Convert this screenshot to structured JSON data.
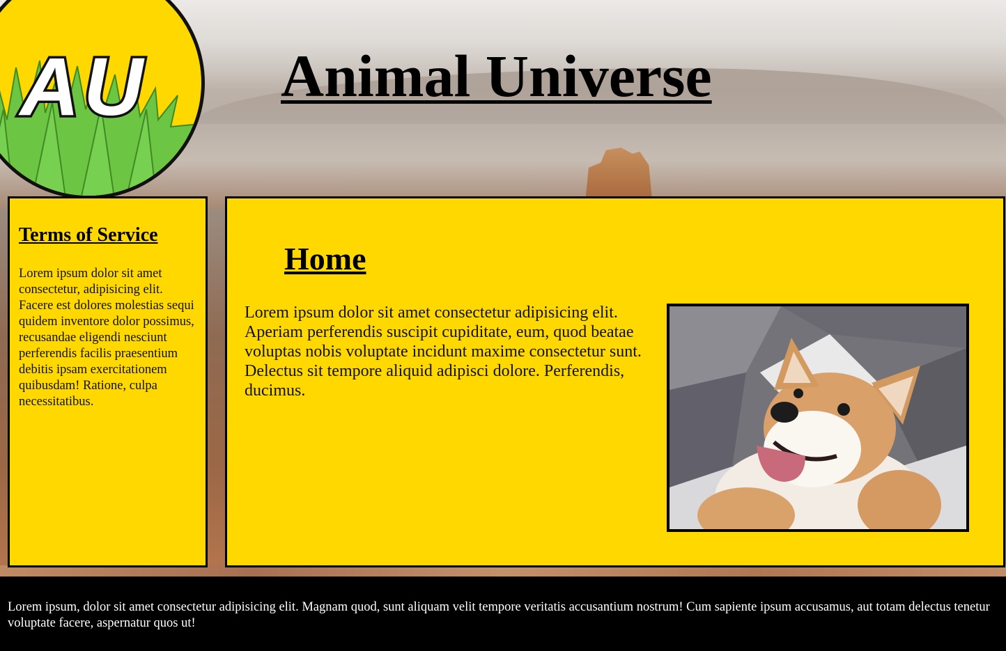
{
  "logo": {
    "text": "AU",
    "icon": "animal-universe-logo-icon",
    "color": "#ffd800"
  },
  "header": {
    "title": "Animal Universe"
  },
  "sidebar": {
    "heading": "Terms of Service",
    "text": "Lorem ipsum dolor sit amet consectetur, adipisicing elit. Facere est dolores molestias sequi quidem inventore dolor possimus, recusandae eligendi nesciunt perferendis facilis praesentium debitis ipsam exercitationem quibusdam! Ratione, culpa necessitatibus."
  },
  "main": {
    "heading": "Home",
    "text": "Lorem ipsum dolor sit amet consectetur adipisicing elit. Aperiam perferendis suscipit cupiditate, eum, quod beatae voluptas nobis voluptate incidunt maxime consectetur sunt. Delectus sit tempore aliquid adipisci dolore. Perferendis, ducimus.",
    "image": "corgi-dog-photo"
  },
  "footer": {
    "text": "Lorem ipsum, dolor sit amet consectetur adipisicing elit. Magnam quod, sunt aliquam velit tempore veritatis accusantium nostrum! Cum sapiente ipsum accusamus, aut totam delectus tenetur voluptate facere, aspernatur quos ut!"
  },
  "colors": {
    "panel": "#ffd800",
    "border": "#000000",
    "footer_bg": "#000000",
    "footer_text": "#ffffff"
  }
}
